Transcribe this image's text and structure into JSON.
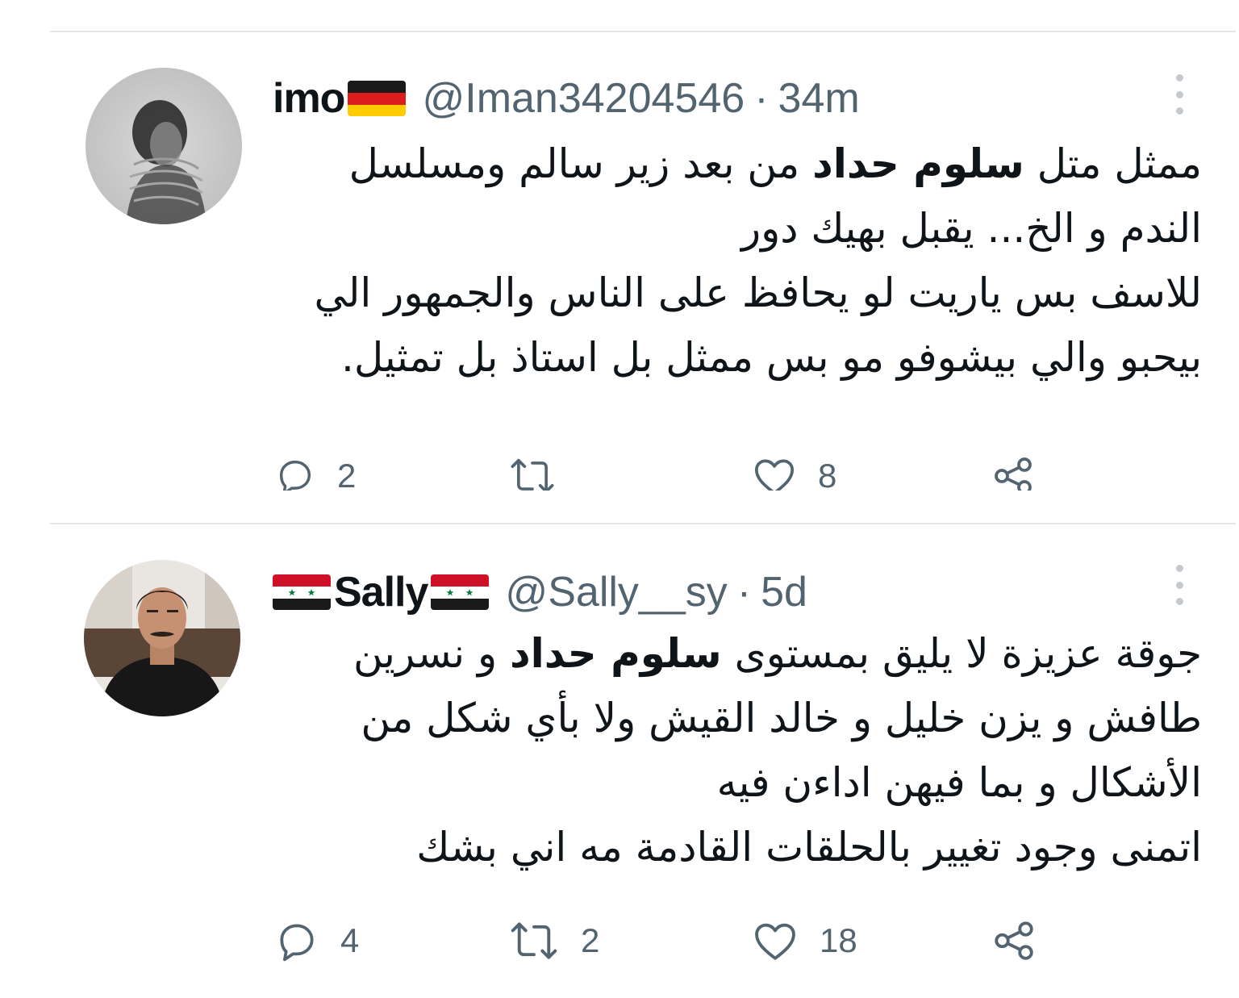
{
  "tweets": [
    {
      "display_name": "imo",
      "name_flags": [
        "germany-flag"
      ],
      "handle": "@Iman34204546",
      "separator": "·",
      "time": "34m",
      "text_lines": [
        {
          "before": "ممثل متل ",
          "bold": "سلوم حداد",
          "after": " من بعد زير سالم ومسلسل"
        },
        {
          "before": "الندم و الخ... يقبل بهيك دور",
          "bold": "",
          "after": ""
        },
        {
          "before": "للاسف بس ياريت لو يحافظ على الناس والجمهور الي",
          "bold": "",
          "after": ""
        },
        {
          "before": "بيحبو والي بيشوفو مو بس ممثل بل استاذ بل تمثيل.",
          "bold": "",
          "after": ""
        }
      ],
      "actions": {
        "reply": {
          "icon": "reply-icon",
          "count": "2"
        },
        "retweet": {
          "icon": "retweet-icon",
          "count": ""
        },
        "like": {
          "icon": "heart-icon",
          "count": "8"
        },
        "share": {
          "icon": "share-icon"
        }
      }
    },
    {
      "display_name": "Sally",
      "name_flags": [
        "syria-flag",
        "syria-flag"
      ],
      "handle": "@Sally__sy",
      "separator": "·",
      "time": "5d",
      "text_lines": [
        {
          "before": "جوقة عزيزة لا يليق بمستوى ",
          "bold": "سلوم حداد",
          "after": " و نسرين"
        },
        {
          "before": "طافش و يزن خليل و خالد القيش ولا بأي شكل من",
          "bold": "",
          "after": ""
        },
        {
          "before": "الأشكال و بما فيهن اداءن فيه",
          "bold": "",
          "after": ""
        },
        {
          "before": "اتمنى وجود تغيير بالحلقات القادمة مه اني بشك",
          "bold": "",
          "after": ""
        }
      ],
      "actions": {
        "reply": {
          "icon": "reply-icon",
          "count": "4"
        },
        "retweet": {
          "icon": "retweet-icon",
          "count": "2"
        },
        "like": {
          "icon": "heart-icon",
          "count": "18"
        },
        "share": {
          "icon": "share-icon"
        }
      }
    }
  ],
  "colors": {
    "text": "#0f1419",
    "secondary": "#536471",
    "divider": "#e6e6e6"
  }
}
